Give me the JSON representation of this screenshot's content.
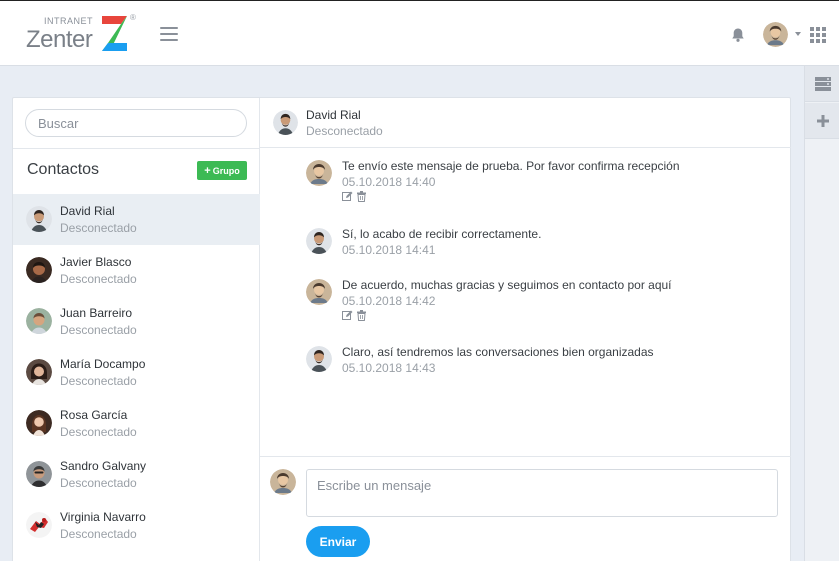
{
  "header": {
    "logo_small": "INTRANET",
    "logo_word": "Zenter",
    "logo_reg": "®",
    "menu_icon": "hamburger-icon",
    "notification_icon": "bell-icon",
    "apps_icon": "grid-apps-icon"
  },
  "rail": {
    "items": [
      {
        "icon": "server-list-icon"
      },
      {
        "icon": "plus-icon"
      }
    ]
  },
  "sidebar": {
    "search_placeholder": "Buscar",
    "title": "Contactos",
    "group_button": "Grupo",
    "contacts": [
      {
        "name": "David Rial",
        "status": "Desconectado",
        "active": true
      },
      {
        "name": "Javier Blasco",
        "status": "Desconectado"
      },
      {
        "name": "Juan Barreiro",
        "status": "Desconectado"
      },
      {
        "name": "María Docampo",
        "status": "Desconectado"
      },
      {
        "name": "Rosa García",
        "status": "Desconectado"
      },
      {
        "name": "Sandro Galvany",
        "status": "Desconectado"
      },
      {
        "name": "Virginia Navarro",
        "status": "Desconectado"
      }
    ]
  },
  "chat": {
    "contact_name": "David Rial",
    "contact_status": "Desconectado",
    "messages": [
      {
        "text": "Te envío este mensaje de prueba. Por favor confirma recepción",
        "time": "05.10.2018 14:40",
        "own": true
      },
      {
        "text": "Sí, lo acabo de recibir correctamente.",
        "time": "05.10.2018 14:41",
        "own": false
      },
      {
        "text": "De acuerdo, muchas gracias y seguimos en contacto por aquí",
        "time": "05.10.2018 14:42",
        "own": true
      },
      {
        "text": "Claro, así tendremos las conversaciones bien organizadas",
        "time": "05.10.2018 14:43",
        "own": false
      }
    ],
    "compose_placeholder": "Escribe un mensaje",
    "send_label": "Enviar"
  },
  "colors": {
    "accent": "#1a9ef0",
    "group_green": "#3cba54",
    "logo_z_blue": "#1a9ef0",
    "logo_z_green": "#3cba54",
    "logo_z_red": "#e8453c"
  }
}
